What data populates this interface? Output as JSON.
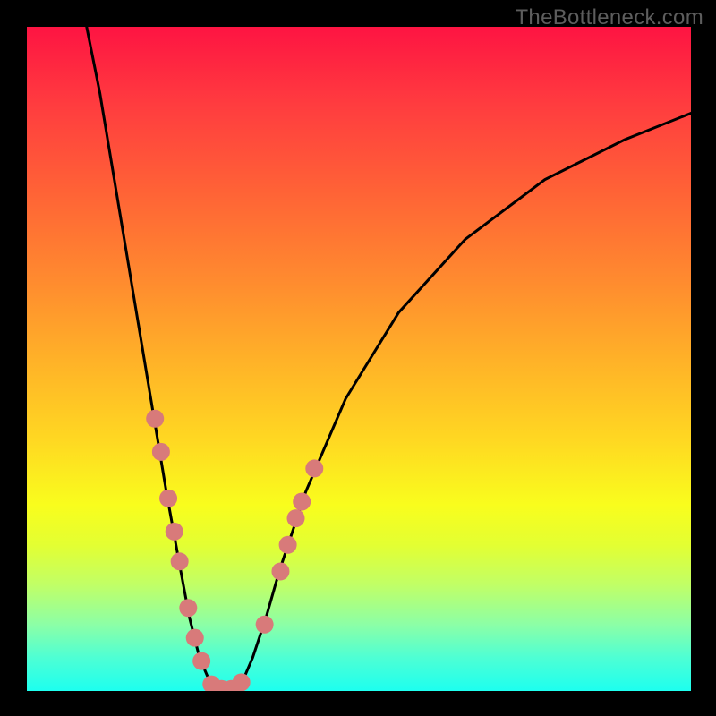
{
  "watermark": "TheBottleneck.com",
  "chart_data": {
    "type": "line",
    "title": "",
    "xlabel": "",
    "ylabel": "",
    "xlim": [
      0,
      100
    ],
    "ylim": [
      0,
      100
    ],
    "gradient_stops": [
      {
        "pos": 0,
        "color": "#fe1442"
      },
      {
        "pos": 12,
        "color": "#ff3d3f"
      },
      {
        "pos": 25,
        "color": "#ff6336"
      },
      {
        "pos": 38,
        "color": "#ff8a2f"
      },
      {
        "pos": 50,
        "color": "#ffb128"
      },
      {
        "pos": 62,
        "color": "#ffd722"
      },
      {
        "pos": 72,
        "color": "#f9fd1d"
      },
      {
        "pos": 78,
        "color": "#e3ff32"
      },
      {
        "pos": 84,
        "color": "#c1ff66"
      },
      {
        "pos": 90,
        "color": "#8cffa6"
      },
      {
        "pos": 95,
        "color": "#4effd4"
      },
      {
        "pos": 100,
        "color": "#1dffef"
      }
    ],
    "series": [
      {
        "name": "v-curve",
        "type": "path",
        "stroke": "#000000",
        "stroke_width": 3,
        "values": [
          {
            "x": 9.0,
            "y": 100
          },
          {
            "x": 11.0,
            "y": 90
          },
          {
            "x": 13.0,
            "y": 78
          },
          {
            "x": 15.0,
            "y": 66
          },
          {
            "x": 17.0,
            "y": 54
          },
          {
            "x": 19.0,
            "y": 42
          },
          {
            "x": 21.0,
            "y": 30
          },
          {
            "x": 23.0,
            "y": 19
          },
          {
            "x": 24.5,
            "y": 11
          },
          {
            "x": 26.0,
            "y": 5
          },
          {
            "x": 27.5,
            "y": 1.5
          },
          {
            "x": 29.0,
            "y": 0.3
          },
          {
            "x": 31.0,
            "y": 0.3
          },
          {
            "x": 32.5,
            "y": 1.5
          },
          {
            "x": 34.0,
            "y": 5
          },
          {
            "x": 36.0,
            "y": 11
          },
          {
            "x": 38.0,
            "y": 18
          },
          {
            "x": 42.0,
            "y": 30
          },
          {
            "x": 48.0,
            "y": 44
          },
          {
            "x": 56.0,
            "y": 57
          },
          {
            "x": 66.0,
            "y": 68
          },
          {
            "x": 78.0,
            "y": 77
          },
          {
            "x": 90.0,
            "y": 83
          },
          {
            "x": 100.0,
            "y": 87
          }
        ]
      },
      {
        "name": "left-dots",
        "type": "scatter",
        "fill": "#d87a7a",
        "radius": 10,
        "values": [
          {
            "x": 19.3,
            "y": 41
          },
          {
            "x": 20.2,
            "y": 36
          },
          {
            "x": 21.3,
            "y": 29
          },
          {
            "x": 22.2,
            "y": 24
          },
          {
            "x": 23.0,
            "y": 19.5
          },
          {
            "x": 24.3,
            "y": 12.5
          },
          {
            "x": 25.3,
            "y": 8
          },
          {
            "x": 26.3,
            "y": 4.5
          }
        ]
      },
      {
        "name": "bottom-dots",
        "type": "scatter",
        "fill": "#d87a7a",
        "radius": 10,
        "values": [
          {
            "x": 27.8,
            "y": 1
          },
          {
            "x": 29.3,
            "y": 0.3
          },
          {
            "x": 30.8,
            "y": 0.3
          },
          {
            "x": 32.3,
            "y": 1.3
          }
        ]
      },
      {
        "name": "right-dots",
        "type": "scatter",
        "fill": "#d87a7a",
        "radius": 10,
        "values": [
          {
            "x": 35.8,
            "y": 10
          },
          {
            "x": 38.2,
            "y": 18
          },
          {
            "x": 39.3,
            "y": 22
          },
          {
            "x": 40.5,
            "y": 26
          },
          {
            "x": 41.4,
            "y": 28.5
          },
          {
            "x": 43.3,
            "y": 33.5
          }
        ]
      }
    ]
  }
}
